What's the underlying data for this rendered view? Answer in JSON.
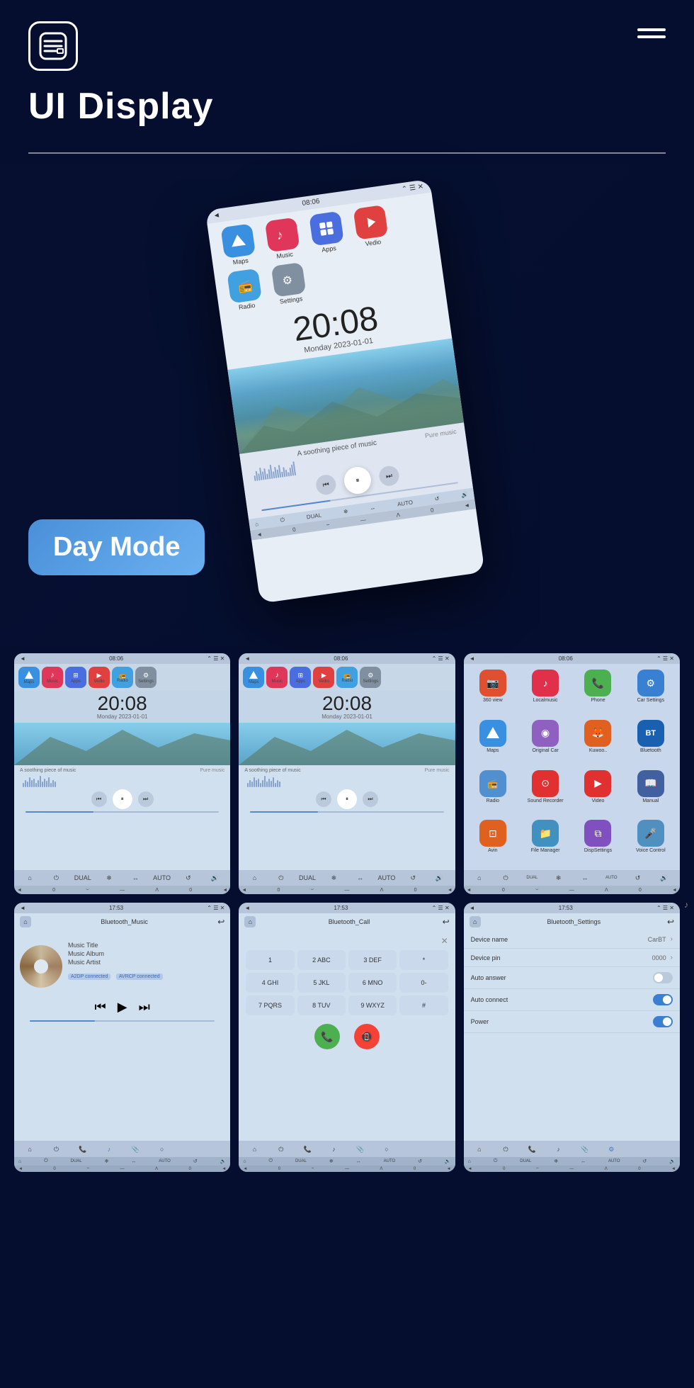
{
  "header": {
    "title": "UI Display",
    "menu_label": "menu"
  },
  "main_phone": {
    "status_bar": {
      "icon": "◄",
      "time": "08:06",
      "icons": "⌃ ☰ ✕"
    },
    "apps": [
      {
        "name": "Maps",
        "color": "#3a90e0",
        "icon": "▲",
        "bg": "#3a90e0"
      },
      {
        "name": "Music",
        "color": "#e0365a",
        "icon": "♪",
        "bg": "#e0365a"
      },
      {
        "name": "Apps",
        "color": "#4a6ee0",
        "icon": "⊞",
        "bg": "#4a6ee0"
      },
      {
        "name": "Vedio",
        "color": "#e04040",
        "icon": "▶",
        "bg": "#e04040"
      },
      {
        "name": "Radio",
        "color": "#40a0e0",
        "icon": "📻",
        "bg": "#40a0e0"
      },
      {
        "name": "Settings",
        "color": "#808080",
        "icon": "⚙",
        "bg": "#808080"
      }
    ],
    "clock": {
      "time": "20:08",
      "date": "Monday  2023-01-01"
    },
    "music": {
      "text": "A soothing piece of music",
      "label_right": "Pure music"
    }
  },
  "day_mode": {
    "label": "Day Mode"
  },
  "top_screenshots": [
    {
      "id": "sc1",
      "type": "music",
      "time": "08:06",
      "clock_time": "20:08",
      "clock_date": "Monday  2023-01-01",
      "music_text_left": "A soothing piece of music",
      "music_text_right": "Pure music"
    },
    {
      "id": "sc2",
      "type": "music",
      "time": "08:06",
      "clock_time": "20:08",
      "clock_date": "Monday  2023-01-01",
      "music_text_left": "A soothing piece of music",
      "music_text_right": "Pure music"
    },
    {
      "id": "sc3",
      "type": "apps",
      "time": "08:06",
      "apps": [
        {
          "name": "360 view",
          "icon": "📷",
          "bg": "#e05030"
        },
        {
          "name": "Localmusic",
          "icon": "♪",
          "bg": "#e0304a"
        },
        {
          "name": "Phone",
          "icon": "📞",
          "bg": "#4caf50"
        },
        {
          "name": "Car Settings",
          "icon": "⚙",
          "bg": "#3a80d2"
        },
        {
          "name": "Maps",
          "icon": "▲",
          "bg": "#3a90e0"
        },
        {
          "name": "Original Car",
          "icon": "◉",
          "bg": "#9060c0"
        },
        {
          "name": "Kuwoo..",
          "icon": "🦊",
          "bg": "#e06020"
        },
        {
          "name": "BT",
          "icon": "BT",
          "bg": "#1a60b0"
        },
        {
          "name": "Radio",
          "icon": "📻",
          "bg": "#5090d0"
        },
        {
          "name": "Sound Recorder",
          "icon": "⊙",
          "bg": "#e03030"
        },
        {
          "name": "Video",
          "icon": "▶",
          "bg": "#e03030"
        },
        {
          "name": "Manual",
          "icon": "📖",
          "bg": "#4060a0"
        },
        {
          "name": "Avin",
          "icon": "⊡",
          "bg": "#e06020"
        },
        {
          "name": "File Manager",
          "icon": "📁",
          "bg": "#4090c0"
        },
        {
          "name": "DispSettings",
          "icon": "⧉",
          "bg": "#8050c0"
        },
        {
          "name": "Voice Control",
          "icon": "🎤",
          "bg": "#5090c0"
        }
      ]
    }
  ],
  "bottom_screenshots": [
    {
      "id": "bt1",
      "type": "bluetooth_music",
      "time": "17:53",
      "title": "Bluetooth_Music",
      "music_title": "Music Title",
      "music_album": "Music Album",
      "music_artist": "Music Artist",
      "tags": [
        "A2DP connected",
        "AVRCP connected"
      ]
    },
    {
      "id": "bt2",
      "type": "bluetooth_call",
      "time": "17:53",
      "title": "Bluetooth_Call",
      "keypad": [
        "1",
        "2ABC",
        "3DEF",
        "*",
        "4GHI",
        "5JKL",
        "6MNO",
        "0-",
        "7PQRS",
        "8TUV",
        "9WXYZ",
        "#"
      ]
    },
    {
      "id": "bt3",
      "type": "bluetooth_settings",
      "time": "17:53",
      "title": "Bluetooth_Settings",
      "settings": [
        {
          "label": "Device name",
          "value": "CarBT",
          "type": "nav"
        },
        {
          "label": "Device pin",
          "value": "0000",
          "type": "nav"
        },
        {
          "label": "Auto answer",
          "value": "",
          "type": "toggle_off"
        },
        {
          "label": "Auto connect",
          "value": "",
          "type": "toggle_on"
        },
        {
          "label": "Power",
          "value": "",
          "type": "toggle_on"
        }
      ]
    }
  ],
  "nav_apps": [
    {
      "name": "Maps",
      "color": "#3a90e0",
      "icon": "▲"
    },
    {
      "name": "Music",
      "color": "#e0365a",
      "icon": "♪"
    },
    {
      "name": "Apps",
      "color": "#4a6ee0",
      "icon": "⊞"
    },
    {
      "name": "Vedio",
      "color": "#e04040",
      "icon": "▶"
    },
    {
      "name": "Radio",
      "color": "#40a0e0",
      "icon": "~"
    },
    {
      "name": "Settings",
      "color": "#808080",
      "icon": "⚙"
    }
  ],
  "bottom_nav_icons": [
    "⌂",
    "⏻",
    "⊗",
    "❄",
    "↔",
    "AUTO",
    "↺",
    "🔊"
  ],
  "bottom_nav_icons2": [
    "◄",
    "0",
    "⌣",
    "—",
    "Λ",
    "0",
    "◄"
  ]
}
